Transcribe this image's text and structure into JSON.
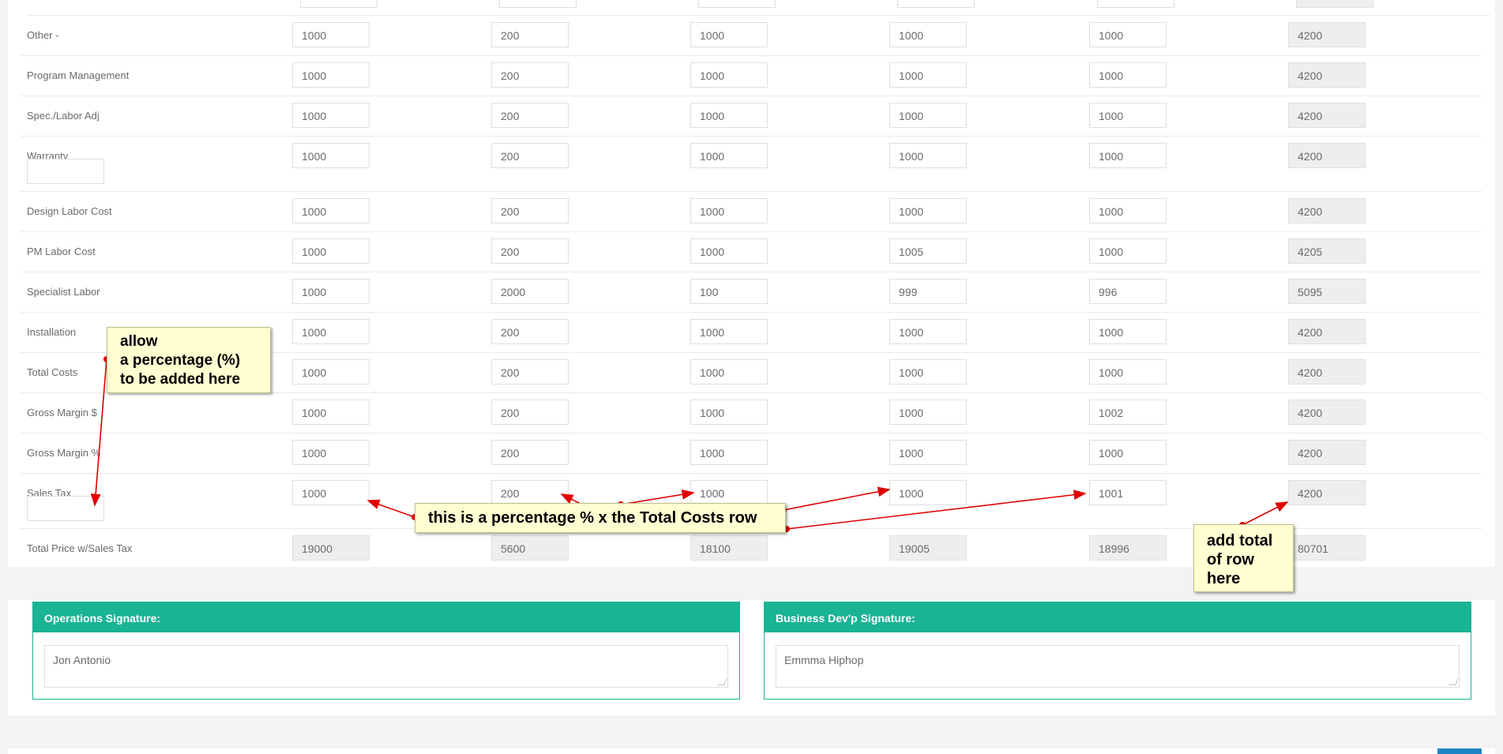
{
  "rows": [
    {
      "label": "Other -",
      "values": [
        "1000",
        "200",
        "1000",
        "1000",
        "1000"
      ],
      "total": "4200"
    },
    {
      "label": "Program Management",
      "values": [
        "1000",
        "200",
        "1000",
        "1000",
        "1000"
      ],
      "total": "4200"
    },
    {
      "label": "Spec./Labor Adj",
      "values": [
        "1000",
        "200",
        "1000",
        "1000",
        "1000"
      ],
      "total": "4200"
    },
    {
      "label": "Warranty",
      "values": [
        "1000",
        "200",
        "1000",
        "1000",
        "1000"
      ],
      "total": "4200"
    },
    {
      "label": "Design Labor Cost",
      "values": [
        "1000",
        "200",
        "1000",
        "1000",
        "1000"
      ],
      "total": "4200"
    },
    {
      "label": "PM Labor Cost",
      "values": [
        "1000",
        "200",
        "1000",
        "1005",
        "1000"
      ],
      "total": "4205"
    },
    {
      "label": "Specialist Labor",
      "values": [
        "1000",
        "2000",
        "100",
        "999",
        "996"
      ],
      "total": "5095"
    },
    {
      "label": "Installation",
      "values": [
        "1000",
        "200",
        "1000",
        "1000",
        "1000"
      ],
      "total": "4200"
    },
    {
      "label": "Total Costs",
      "values": [
        "1000",
        "200",
        "1000",
        "1000",
        "1000"
      ],
      "total": "4200"
    },
    {
      "label": "Gross Margin $",
      "values": [
        "1000",
        "200",
        "1000",
        "1000",
        "1002"
      ],
      "total": "4200"
    },
    {
      "label": "Gross Margin %",
      "values": [
        "1000",
        "200",
        "1000",
        "1000",
        "1000"
      ],
      "total": "4200"
    },
    {
      "label": "Sales Tax",
      "values": [
        "1000",
        "200",
        "1000",
        "1000",
        "1001"
      ],
      "total": "4200"
    },
    {
      "label": "Total Price w/Sales Tax",
      "values": [
        "19000",
        "5600",
        "18100",
        "19005",
        "18996"
      ],
      "total": "80701"
    }
  ],
  "signatures": {
    "operations": {
      "title": "Operations Signature:",
      "value": "Jon Antonio"
    },
    "business": {
      "title": "Business Dev'p Signature:",
      "value": "Emmma Hiphop"
    }
  },
  "annotations": {
    "note1": [
      "allow",
      "a percentage (%)",
      "to be added here"
    ],
    "note2": "this is a percentage % x the Total Costs row",
    "note3": [
      "add total",
      "of row",
      "here"
    ]
  },
  "colors": {
    "accent": "#1ab394",
    "note_bg": "#ffffd2",
    "arrow": "#e00000",
    "primary_button": "#1c84c6"
  }
}
